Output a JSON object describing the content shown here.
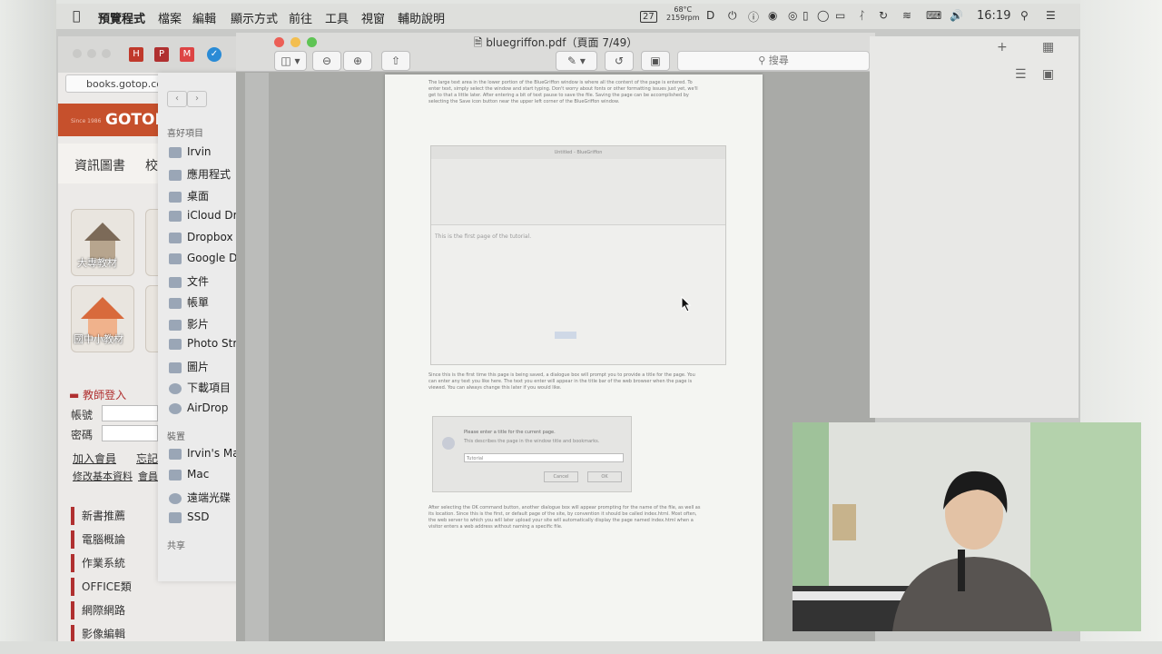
{
  "menubar": {
    "app": "預覽程式",
    "items": [
      "檔案",
      "編輯",
      "顯示方式",
      "前往",
      "工具",
      "視窗",
      "輔助說明"
    ],
    "weather": "68°C",
    "rpm": "2159rpm",
    "calendar_day": "27",
    "time": "16:19"
  },
  "browser": {
    "url": "books.gotop.com",
    "site_logo": "GOTOP",
    "since": "Since 1986",
    "nav": [
      "資訊圖書",
      "校"
    ],
    "tile_label_1": "大專教材",
    "tile_label_2": "國中小教材",
    "login_heading": "教師登入",
    "account_label": "帳號",
    "password_label": "密碼",
    "join_link": "加入會員",
    "forgot_link": "忘記",
    "modify_link": "修改基本資料",
    "member_link": "會員相",
    "categories": [
      "新書推薦",
      "電腦概論",
      "作業系統",
      "OFFICE類",
      "網際網路",
      "影像編輯"
    ]
  },
  "finder": {
    "favorites_heading": "喜好項目",
    "favorites": [
      "Irvin",
      "應用程式",
      "桌面",
      "iCloud Dr",
      "Dropbox",
      "Google D",
      "文件",
      "帳單",
      "影片",
      "Photo Str",
      "圖片",
      "下載項目",
      "AirDrop"
    ],
    "devices_heading": "裝置",
    "devices": [
      "Irvin's Ma",
      "Mac",
      "遠端光碟",
      "SSD"
    ],
    "shared_heading": "共享"
  },
  "preview": {
    "title": "bluegriffon.pdf（頁面 7/49）",
    "search_placeholder": "搜尋",
    "page_paragraph_1": "The large text area in the lower portion of the BlueGriffon window is where all the content of the page is entered. To enter text, simply select the window and start typing. Don't worry about fonts or other formatting issues just yet, we'll get to that a little later. After entering a bit of text pause to save the file. Saving the page can be accomplished by selecting the Save icon button near the upper left corner of the BlueGriffon window.",
    "page_paragraph_2": "Since this is the first time this page is being saved, a dialogue box will prompt you to provide a title for the page. You can enter any text you like here. The text you enter will appear in the title bar of the web browser when the page is viewed. You can always change this later if you would like.",
    "page_paragraph_3": "After selecting the OK command button, another dialogue box will appear prompting for the name of the file, as well as its location. Since this is the first, or default page of the site, by convention it should be called index.html. Most often, the web server to which you will later upload your site will automatically display the page named index.html when a visitor enters a web address without naming a specific file.",
    "shot_title": "Untitled - BlueGriffon",
    "shot_content": "This is the first page of the tutorial.",
    "dialog_title": "Please enter a title for the current page.",
    "dialog_sub": "This describes the page in the window title and bookmarks.",
    "dialog_value": "Tutorial",
    "dialog_cancel": "Cancel",
    "dialog_ok": "OK"
  },
  "colors": {
    "site_red": "#c6502c",
    "close_red": "#ec5f56",
    "min_yellow": "#f3be4f",
    "max_green": "#5fc454"
  }
}
